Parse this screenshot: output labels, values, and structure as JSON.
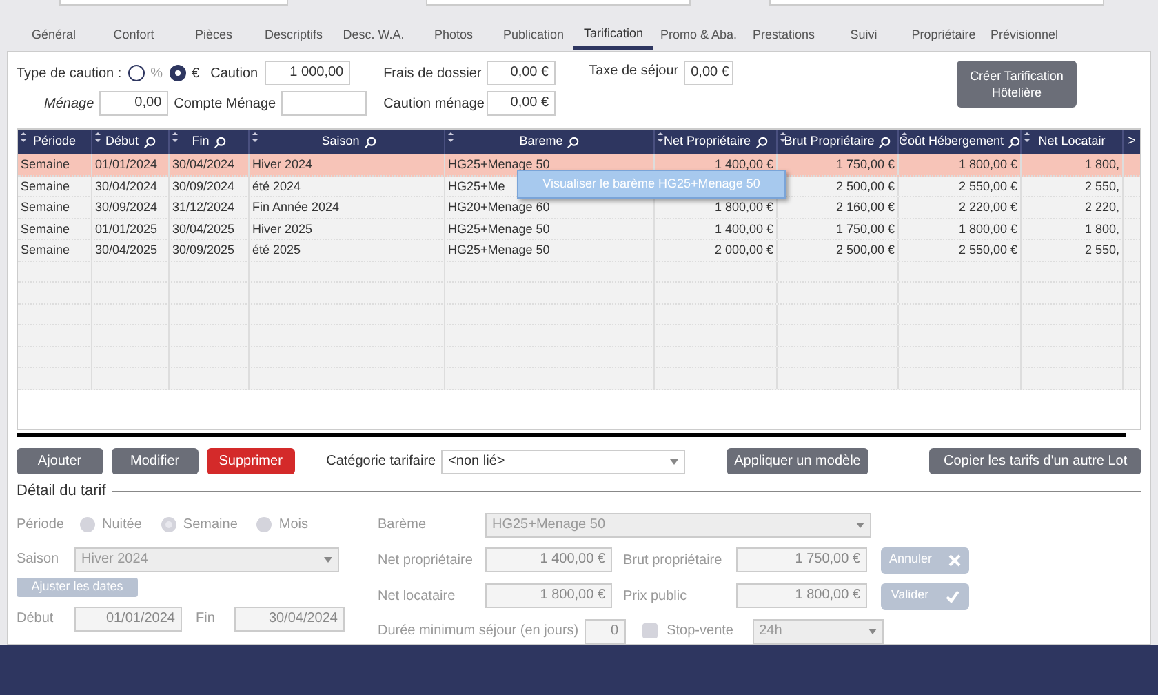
{
  "tabs": [
    {
      "label": "Général",
      "selected": false
    },
    {
      "label": "Confort",
      "selected": false
    },
    {
      "label": "Pièces",
      "selected": false
    },
    {
      "label": "Descriptifs",
      "selected": false
    },
    {
      "label": "Desc. W.A.",
      "selected": false
    },
    {
      "label": "Photos",
      "selected": false
    },
    {
      "label": "Publication",
      "selected": false
    },
    {
      "label": "Tarification",
      "selected": true
    },
    {
      "label": "Promo & Aba.",
      "selected": false
    },
    {
      "label": "Prestations",
      "selected": false
    },
    {
      "label": "Suivi",
      "selected": false
    },
    {
      "label": "Propriétaire",
      "selected": false
    },
    {
      "label": "Prévisionnel",
      "selected": false
    }
  ],
  "caution": {
    "label": "Type de caution :",
    "options": [
      {
        "label": "%",
        "selected": false
      },
      {
        "label": "€",
        "selected": true
      }
    ],
    "caution_label": "Caution",
    "caution_value": "1 000,00",
    "frais_label": "Frais de dossier",
    "frais_value": "0,00 €",
    "taxe_label": "Taxe de séjour",
    "taxe_value": "0,00 €",
    "menage_label": "Ménage",
    "menage_value": "0,00",
    "compte_label": "Compte Ménage",
    "caution_menage_label": "Caution ménage",
    "caution_menage_value": "0,00 €",
    "create_button": "Créer Tarification Hôtelière"
  },
  "table": {
    "columns": [
      {
        "label": "Période",
        "search": false
      },
      {
        "label": "Début",
        "search": true
      },
      {
        "label": "Fin",
        "search": true
      },
      {
        "label": "Saison",
        "search": true
      },
      {
        "label": "Bareme",
        "search": true
      },
      {
        "label": "Net Propriétaire",
        "search": true
      },
      {
        "label": "Brut Propriétaire",
        "search": true
      },
      {
        "label": "Coût Hébergement",
        "search": true
      },
      {
        "label": "Net Locatair",
        "search": false
      }
    ],
    "scroll_right": ">",
    "rows": [
      {
        "selected": true,
        "cells": [
          "Semaine",
          "01/01/2024",
          "30/04/2024",
          "Hiver 2024",
          "HG25+Menage 50",
          "1 400,00 €",
          "1 750,00 €",
          "1 800,00 €",
          "1 800,"
        ]
      },
      {
        "selected": false,
        "cells": [
          "Semaine",
          "30/04/2024",
          "30/09/2024",
          "été 2024",
          "HG25+Me",
          null,
          "2 500,00 €",
          "2 550,00 €",
          "2 550,"
        ]
      },
      {
        "selected": false,
        "cells": [
          "Semaine",
          "30/09/2024",
          "31/12/2024",
          "Fin Année 2024",
          "HG20+Menage 60",
          "1 800,00 €",
          "2 160,00 €",
          "2 220,00 €",
          "2 220,"
        ]
      },
      {
        "selected": false,
        "cells": [
          "Semaine",
          "01/01/2025",
          "30/04/2025",
          "Hiver 2025",
          "HG25+Menage 50",
          "1 400,00 €",
          "1 750,00 €",
          "1 800,00 €",
          "1 800,"
        ]
      },
      {
        "selected": false,
        "cells": [
          "Semaine",
          "30/04/2025",
          "30/09/2025",
          "été 2025",
          "HG25+Menage 50",
          "2 000,00 €",
          "2 500,00 €",
          "2 550,00 €",
          "2 550,"
        ]
      }
    ],
    "tooltip": "Visualiser le barème HG25+Menage 50"
  },
  "actions": {
    "ajouter": "Ajouter",
    "modifier": "Modifier",
    "supprimer": "Supprimer",
    "categorie_label": "Catégorie tarifaire",
    "categorie_value": "<non lié>",
    "appliquer": "Appliquer un modèle",
    "copier": "Copier les tarifs d'un autre Lot"
  },
  "detail": {
    "title": "Détail du tarif",
    "periode_label": "Période",
    "periode_options": [
      {
        "label": "Nuitée",
        "selected": false
      },
      {
        "label": "Semaine",
        "selected": true
      },
      {
        "label": "Mois",
        "selected": false
      }
    ],
    "saison_label": "Saison",
    "saison_value": "Hiver 2024",
    "ajuster": "Ajuster les dates",
    "debut_label": "Début",
    "debut_value": "01/01/2024",
    "fin_label": "Fin",
    "fin_value": "30/04/2024",
    "bareme_label": "Barème",
    "bareme_value": "HG25+Menage 50",
    "net_prop_label": "Net propriétaire",
    "net_prop_value": "1 400,00 €",
    "net_loc_label": "Net locataire",
    "net_loc_value": "1 800,00 €",
    "duree_label": "Durée minimum séjour (en jours)",
    "duree_value": "0",
    "brut_label": "Brut propriétaire",
    "brut_value": "1 750,00 €",
    "prix_label": "Prix public",
    "prix_value": "1 800,00 €",
    "stop_label": "Stop-vente",
    "stop_checked": false,
    "stop_value": "24h",
    "annuler": "Annuler",
    "valider": "Valider"
  }
}
